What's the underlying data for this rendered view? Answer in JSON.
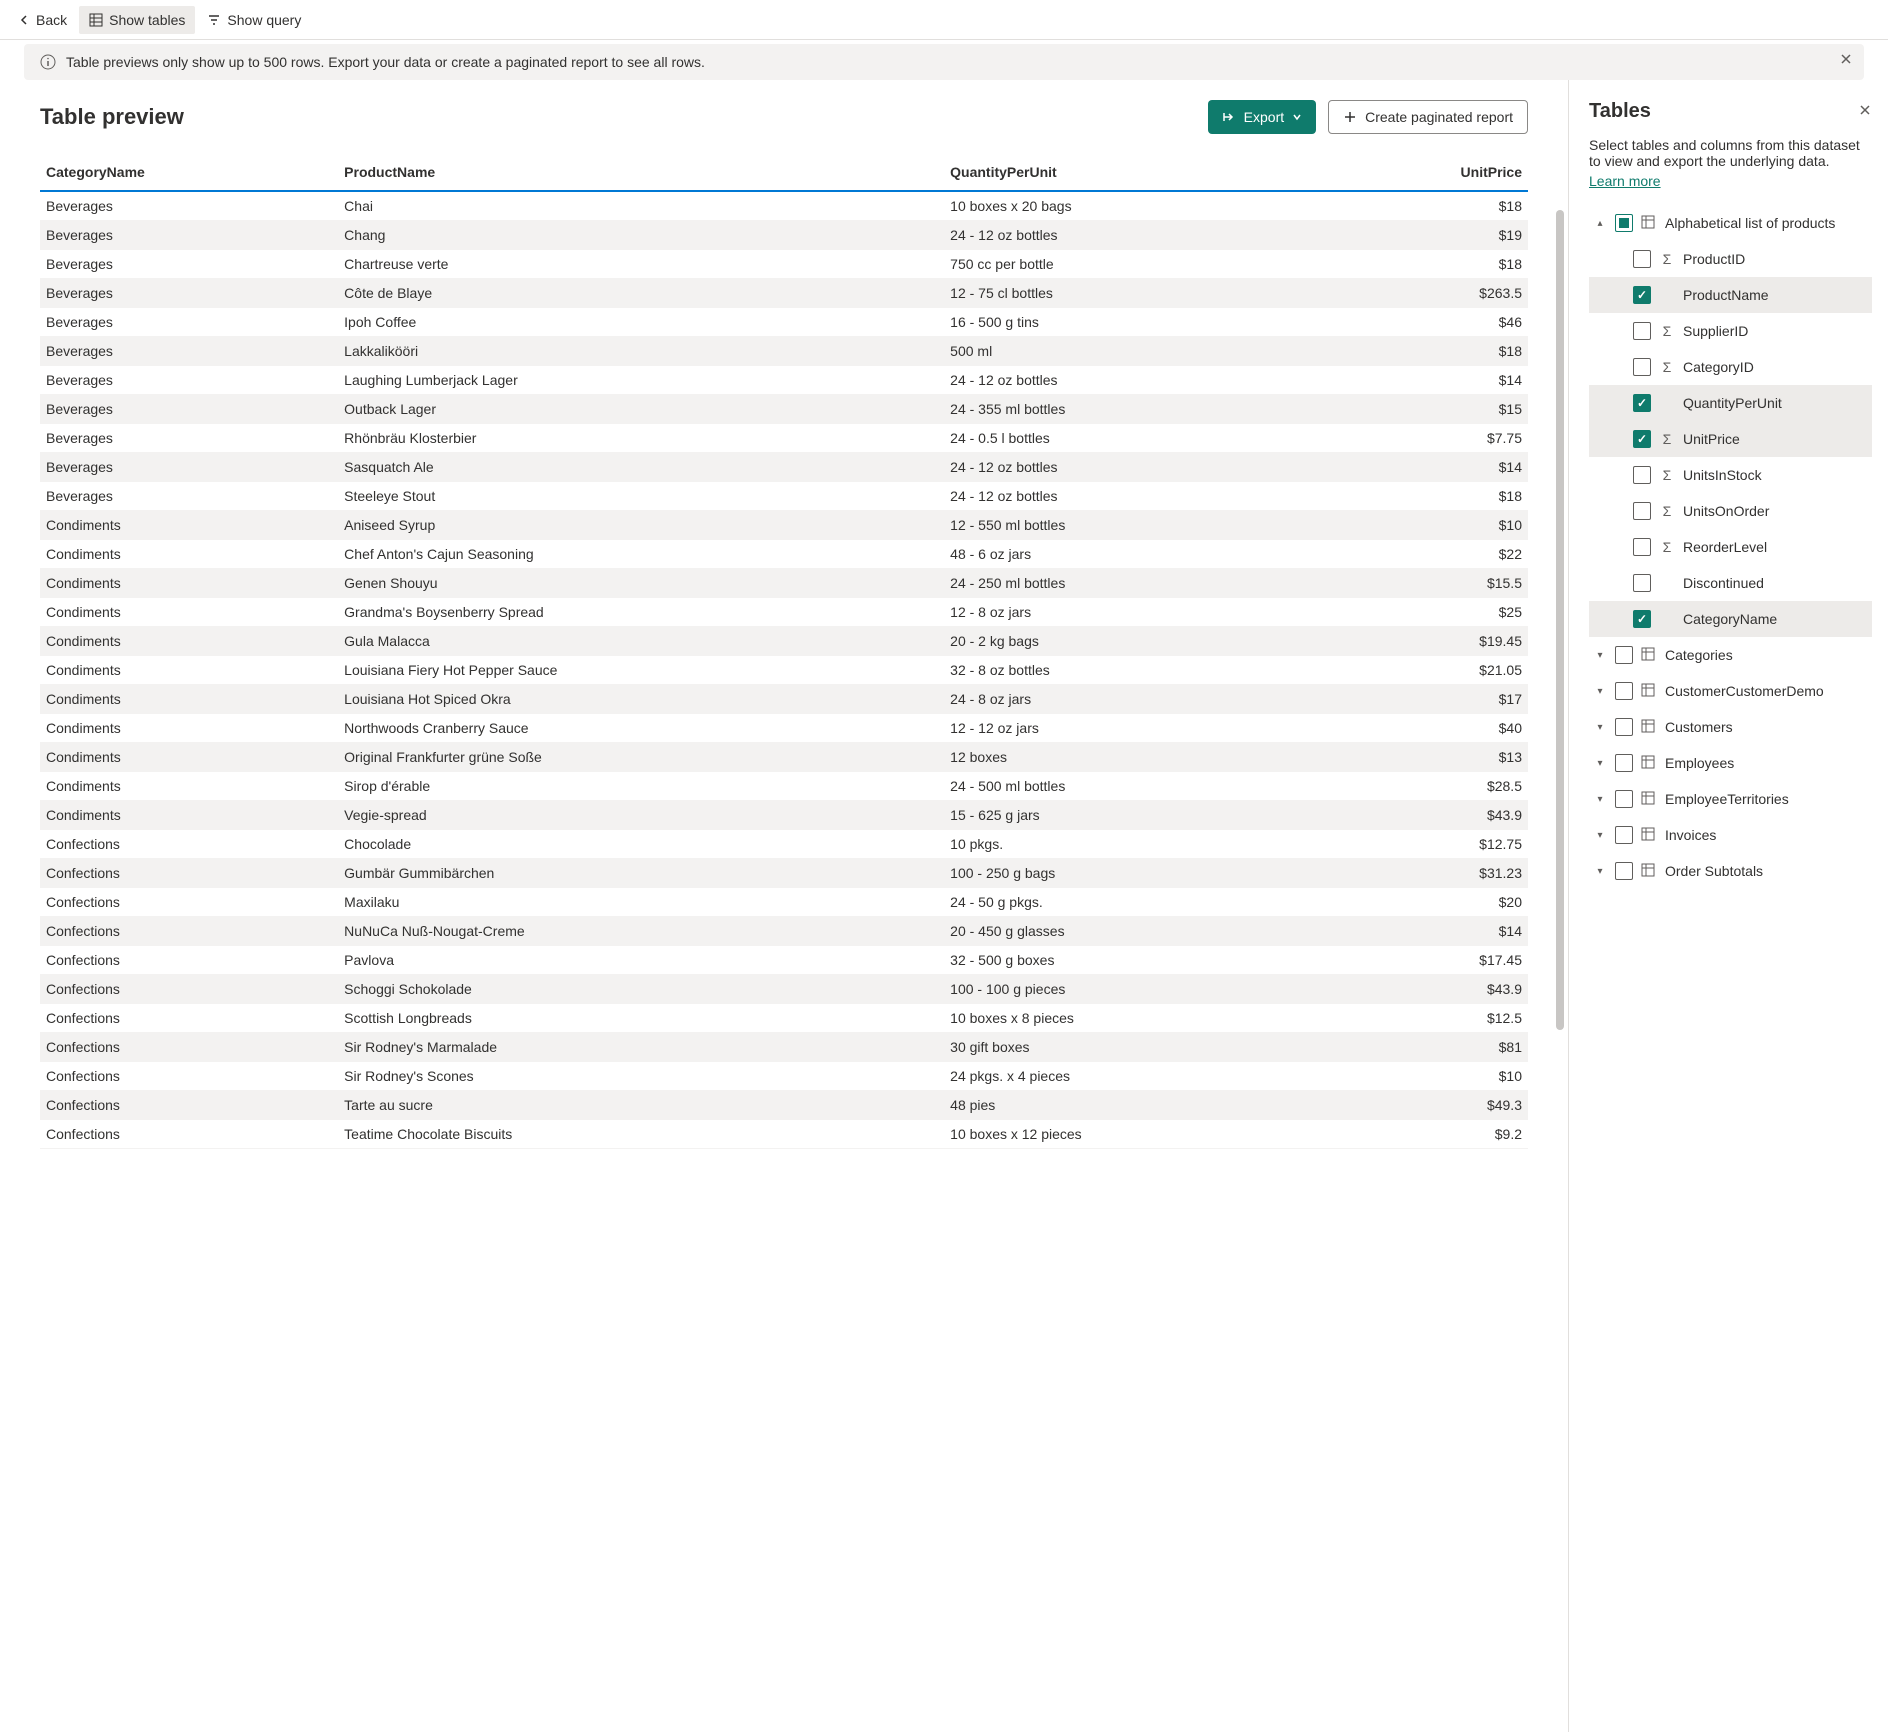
{
  "toolbar": {
    "back": "Back",
    "show_tables": "Show tables",
    "show_query": "Show query"
  },
  "info_bar": "Table previews only show up to 500 rows. Export your data or create a paginated report to see all rows.",
  "title": "Table preview",
  "buttons": {
    "export": "Export",
    "create_report": "Create paginated report"
  },
  "columns": [
    "CategoryName",
    "ProductName",
    "QuantityPerUnit",
    "UnitPrice"
  ],
  "rows": [
    [
      "Beverages",
      "Chai",
      "10 boxes x 20 bags",
      "$18"
    ],
    [
      "Beverages",
      "Chang",
      "24 - 12 oz bottles",
      "$19"
    ],
    [
      "Beverages",
      "Chartreuse verte",
      "750 cc per bottle",
      "$18"
    ],
    [
      "Beverages",
      "Côte de Blaye",
      "12 - 75 cl bottles",
      "$263.5"
    ],
    [
      "Beverages",
      "Ipoh Coffee",
      "16 - 500 g tins",
      "$46"
    ],
    [
      "Beverages",
      "Lakkalikööri",
      "500 ml",
      "$18"
    ],
    [
      "Beverages",
      "Laughing Lumberjack Lager",
      "24 - 12 oz bottles",
      "$14"
    ],
    [
      "Beverages",
      "Outback Lager",
      "24 - 355 ml bottles",
      "$15"
    ],
    [
      "Beverages",
      "Rhönbräu Klosterbier",
      "24 - 0.5 l bottles",
      "$7.75"
    ],
    [
      "Beverages",
      "Sasquatch Ale",
      "24 - 12 oz bottles",
      "$14"
    ],
    [
      "Beverages",
      "Steeleye Stout",
      "24 - 12 oz bottles",
      "$18"
    ],
    [
      "Condiments",
      "Aniseed Syrup",
      "12 - 550 ml bottles",
      "$10"
    ],
    [
      "Condiments",
      "Chef Anton's Cajun Seasoning",
      "48 - 6 oz jars",
      "$22"
    ],
    [
      "Condiments",
      "Genen Shouyu",
      "24 - 250 ml bottles",
      "$15.5"
    ],
    [
      "Condiments",
      "Grandma's Boysenberry Spread",
      "12 - 8 oz jars",
      "$25"
    ],
    [
      "Condiments",
      "Gula Malacca",
      "20 - 2 kg bags",
      "$19.45"
    ],
    [
      "Condiments",
      "Louisiana Fiery Hot Pepper Sauce",
      "32 - 8 oz bottles",
      "$21.05"
    ],
    [
      "Condiments",
      "Louisiana Hot Spiced Okra",
      "24 - 8 oz jars",
      "$17"
    ],
    [
      "Condiments",
      "Northwoods Cranberry Sauce",
      "12 - 12 oz jars",
      "$40"
    ],
    [
      "Condiments",
      "Original Frankfurter grüne Soße",
      "12 boxes",
      "$13"
    ],
    [
      "Condiments",
      "Sirop d'érable",
      "24 - 500 ml bottles",
      "$28.5"
    ],
    [
      "Condiments",
      "Vegie-spread",
      "15 - 625 g jars",
      "$43.9"
    ],
    [
      "Confections",
      "Chocolade",
      "10 pkgs.",
      "$12.75"
    ],
    [
      "Confections",
      "Gumbär Gummibärchen",
      "100 - 250 g bags",
      "$31.23"
    ],
    [
      "Confections",
      "Maxilaku",
      "24 - 50 g pkgs.",
      "$20"
    ],
    [
      "Confections",
      "NuNuCa Nuß-Nougat-Creme",
      "20 - 450 g glasses",
      "$14"
    ],
    [
      "Confections",
      "Pavlova",
      "32 - 500 g boxes",
      "$17.45"
    ],
    [
      "Confections",
      "Schoggi Schokolade",
      "100 - 100 g pieces",
      "$43.9"
    ],
    [
      "Confections",
      "Scottish Longbreads",
      "10 boxes x 8 pieces",
      "$12.5"
    ],
    [
      "Confections",
      "Sir Rodney's Marmalade",
      "30 gift boxes",
      "$81"
    ],
    [
      "Confections",
      "Sir Rodney's Scones",
      "24 pkgs. x 4 pieces",
      "$10"
    ],
    [
      "Confections",
      "Tarte au sucre",
      "48 pies",
      "$49.3"
    ],
    [
      "Confections",
      "Teatime Chocolate Biscuits",
      "10 boxes x 12 pieces",
      "$9.2"
    ]
  ],
  "panel": {
    "title": "Tables",
    "desc": "Select tables and columns from this dataset to view and export the underlying data.",
    "learn_more": "Learn more",
    "expanded_table": "Alphabetical list of products",
    "columns_list": [
      {
        "name": "ProductID",
        "checked": false,
        "sigma": true
      },
      {
        "name": "ProductName",
        "checked": true,
        "sigma": false
      },
      {
        "name": "SupplierID",
        "checked": false,
        "sigma": true
      },
      {
        "name": "CategoryID",
        "checked": false,
        "sigma": true
      },
      {
        "name": "QuantityPerUnit",
        "checked": true,
        "sigma": false
      },
      {
        "name": "UnitPrice",
        "checked": true,
        "sigma": true
      },
      {
        "name": "UnitsInStock",
        "checked": false,
        "sigma": true
      },
      {
        "name": "UnitsOnOrder",
        "checked": false,
        "sigma": true
      },
      {
        "name": "ReorderLevel",
        "checked": false,
        "sigma": true
      },
      {
        "name": "Discontinued",
        "checked": false,
        "sigma": false
      },
      {
        "name": "CategoryName",
        "checked": true,
        "sigma": false
      }
    ],
    "tables": [
      "Categories",
      "CustomerCustomerDemo",
      "Customers",
      "Employees",
      "EmployeeTerritories",
      "Invoices",
      "Order Subtotals"
    ]
  }
}
